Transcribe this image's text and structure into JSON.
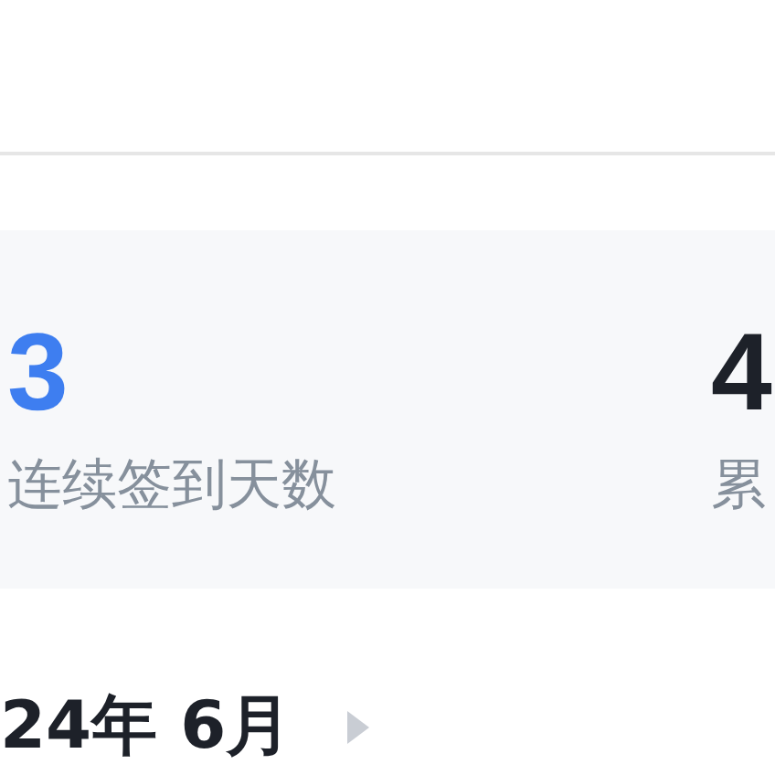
{
  "stats": [
    {
      "value": "3",
      "label": "连续签到天数",
      "color": "#3e7ef0"
    },
    {
      "value": "4",
      "label": "累",
      "color": "#1d2129"
    }
  ],
  "calendar": {
    "month": "24年 6月"
  }
}
